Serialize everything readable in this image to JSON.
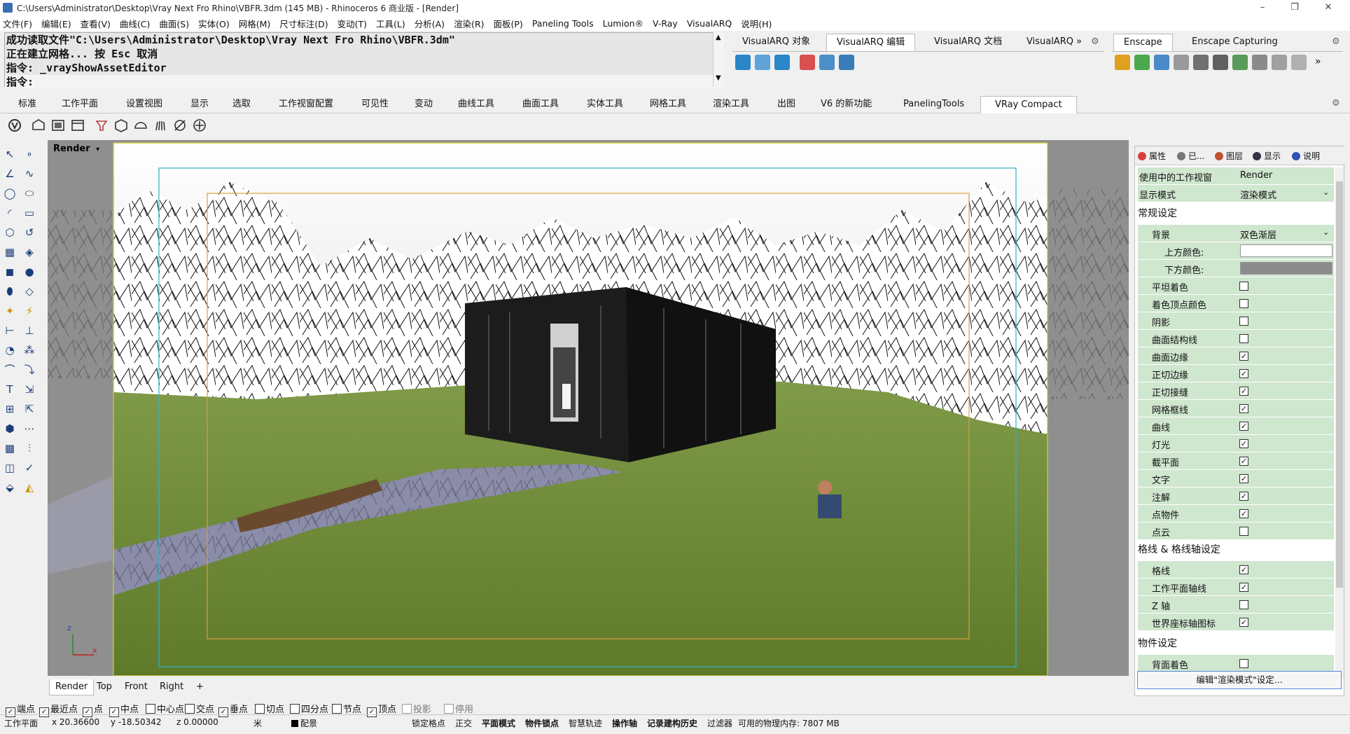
{
  "window": {
    "title": "C:\\Users\\Administrator\\Desktop\\Vray Next Fro Rhino\\VBFR.3dm (145 MB) - Rhinoceros 6 商业版 - [Render]",
    "minimize": "–",
    "maximize": "❐",
    "close": "✕"
  },
  "menu": [
    "文件(F)",
    "编辑(E)",
    "查看(V)",
    "曲线(C)",
    "曲面(S)",
    "实体(O)",
    "网格(M)",
    "尺寸标注(D)",
    "变动(T)",
    "工具(L)",
    "分析(A)",
    "渲染(R)",
    "面板(P)",
    "Paneling Tools",
    "Lumion®",
    "V-Ray",
    "VisualARQ",
    "说明(H)"
  ],
  "command": {
    "history": [
      "成功读取文件\"C:\\Users\\Administrator\\Desktop\\Vray Next Fro Rhino\\VBFR.3dm\"",
      "正在建立网格... 按 Esc 取消",
      "指令: _vrayShowAssetEditor"
    ],
    "prompt": "指令:"
  },
  "visualarq_tabs": [
    "VisualARQ 对象",
    "VisualARQ 编辑",
    "VisualARQ 文档",
    "VisualARQ »"
  ],
  "visualarq_active": 1,
  "enscape_tabs": [
    "Enscape",
    "Enscape Capturing"
  ],
  "main_tabs": [
    "标准",
    "工作平面",
    "设置视图",
    "显示",
    "选取",
    "工作视窗配置",
    "可见性",
    "变动",
    "曲线工具",
    "曲面工具",
    "实体工具",
    "网格工具",
    "渲染工具",
    "出图",
    "V6 的新功能",
    "PanelingTools",
    "VRay Compact"
  ],
  "main_tab_active": 16,
  "viewport": {
    "label": "Render",
    "tabs": [
      "Render",
      "Top",
      "Front",
      "Right"
    ],
    "add": "+",
    "axis_z": "z",
    "axis_x": "x"
  },
  "panel": {
    "tabs": [
      "属性",
      "已...",
      "图层",
      "显示",
      "说明"
    ],
    "active_viewport_label": "使用中的工作视窗",
    "active_viewport_value": "Render",
    "display_mode_label": "显示模式",
    "display_mode_value": "渲染模式",
    "general_section": "常规设定",
    "background_label": "背景",
    "background_value": "双色渐层",
    "top_color_label": "上方颜色:",
    "bottom_color_label": "下方颜色:",
    "general_items": [
      {
        "label": "平坦着色",
        "checked": false
      },
      {
        "label": "着色顶点颜色",
        "checked": false
      },
      {
        "label": "阴影",
        "checked": false
      },
      {
        "label": "曲面结构线",
        "checked": false
      },
      {
        "label": "曲面边缘",
        "checked": true
      },
      {
        "label": "正切边缘",
        "checked": true
      },
      {
        "label": "正切接缝",
        "checked": true
      },
      {
        "label": "网格框线",
        "checked": true
      },
      {
        "label": "曲线",
        "checked": true
      },
      {
        "label": "灯光",
        "checked": true
      },
      {
        "label": "截平面",
        "checked": true
      },
      {
        "label": "文字",
        "checked": true
      },
      {
        "label": "注解",
        "checked": true
      },
      {
        "label": "点物件",
        "checked": true
      },
      {
        "label": "点云",
        "checked": false
      }
    ],
    "grid_section": "格线 & 格线轴设定",
    "grid_items": [
      {
        "label": "格线",
        "checked": true
      },
      {
        "label": "工作平面轴线",
        "checked": true
      },
      {
        "label": "Z 轴",
        "checked": false
      },
      {
        "label": "世界座标轴图标",
        "checked": true
      }
    ],
    "object_section": "物件设定",
    "object_items": [
      {
        "label": "背面着色",
        "checked": false
      }
    ],
    "edit_button": "编辑\"渲染模式\"设定..."
  },
  "osnap": [
    {
      "label": "端点",
      "checked": true
    },
    {
      "label": "最近点",
      "checked": true
    },
    {
      "label": "点",
      "checked": true
    },
    {
      "label": "中点",
      "checked": true
    },
    {
      "label": "中心点",
      "checked": false
    },
    {
      "label": "交点",
      "checked": false
    },
    {
      "label": "垂点",
      "checked": true
    },
    {
      "label": "切点",
      "checked": false
    },
    {
      "label": "四分点",
      "checked": false
    },
    {
      "label": "节点",
      "checked": false
    },
    {
      "label": "顶点",
      "checked": true
    },
    {
      "label": "投影",
      "checked": false
    },
    {
      "label": "停用",
      "checked": false
    }
  ],
  "status": {
    "cplane": "工作平面",
    "x": "x 20.36600",
    "y": "y -18.50342",
    "z": "z 0.00000",
    "unit": "米",
    "layer": "配景",
    "toggles": [
      "锁定格点",
      "正交",
      "平面模式",
      "物件锁点",
      "智慧轨迹",
      "操作轴",
      "记录建构历史",
      "过滤器"
    ],
    "memory": "可用的物理内存: 7807 MB"
  },
  "colors": {
    "accent": "#3c6eb4",
    "panel_row": "#cfe6cf",
    "grass": "#6f8a38",
    "sky_top": "#ffffff",
    "sky_bottom": "#d8d8d8"
  }
}
